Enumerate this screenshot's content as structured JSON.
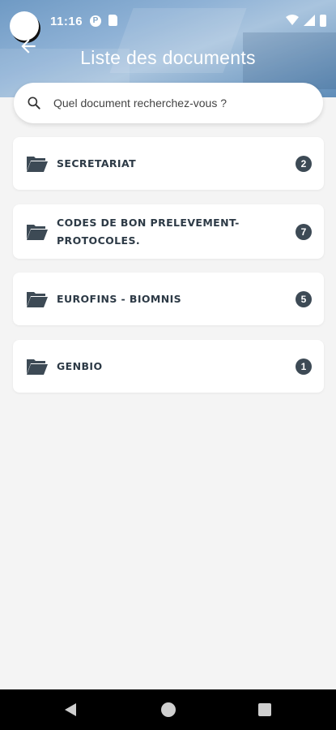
{
  "status_bar": {
    "time": "11:16",
    "icons": [
      "circle-icon",
      "p-icon",
      "sd-card-icon",
      "wifi-icon",
      "signal-icon",
      "battery-icon"
    ]
  },
  "header": {
    "title": "Liste des documents",
    "back_icon": "arrow-left-icon"
  },
  "search": {
    "placeholder": "Quel document recherchez-vous ?",
    "value": "",
    "icon": "search-icon"
  },
  "folders": [
    {
      "label": "SECRETARIAT",
      "count": "2",
      "icon": "folder-open-icon"
    },
    {
      "label": "CODES DE BON PRELEVEMENT-PROTOCOLES.",
      "count": "7",
      "icon": "folder-open-icon"
    },
    {
      "label": "EUROFINS - BIOMNIS",
      "count": "5",
      "icon": "folder-open-icon"
    },
    {
      "label": "GENBIO",
      "count": "1",
      "icon": "folder-open-icon"
    }
  ],
  "nav_bar": {
    "icons": [
      "nav-back-icon",
      "nav-home-icon",
      "nav-recent-icon"
    ]
  },
  "colors": {
    "header_blue": "#7fa5c9",
    "background": "#f4f4f4",
    "text_dark": "#2d3a46",
    "badge": "#3d4a55"
  }
}
